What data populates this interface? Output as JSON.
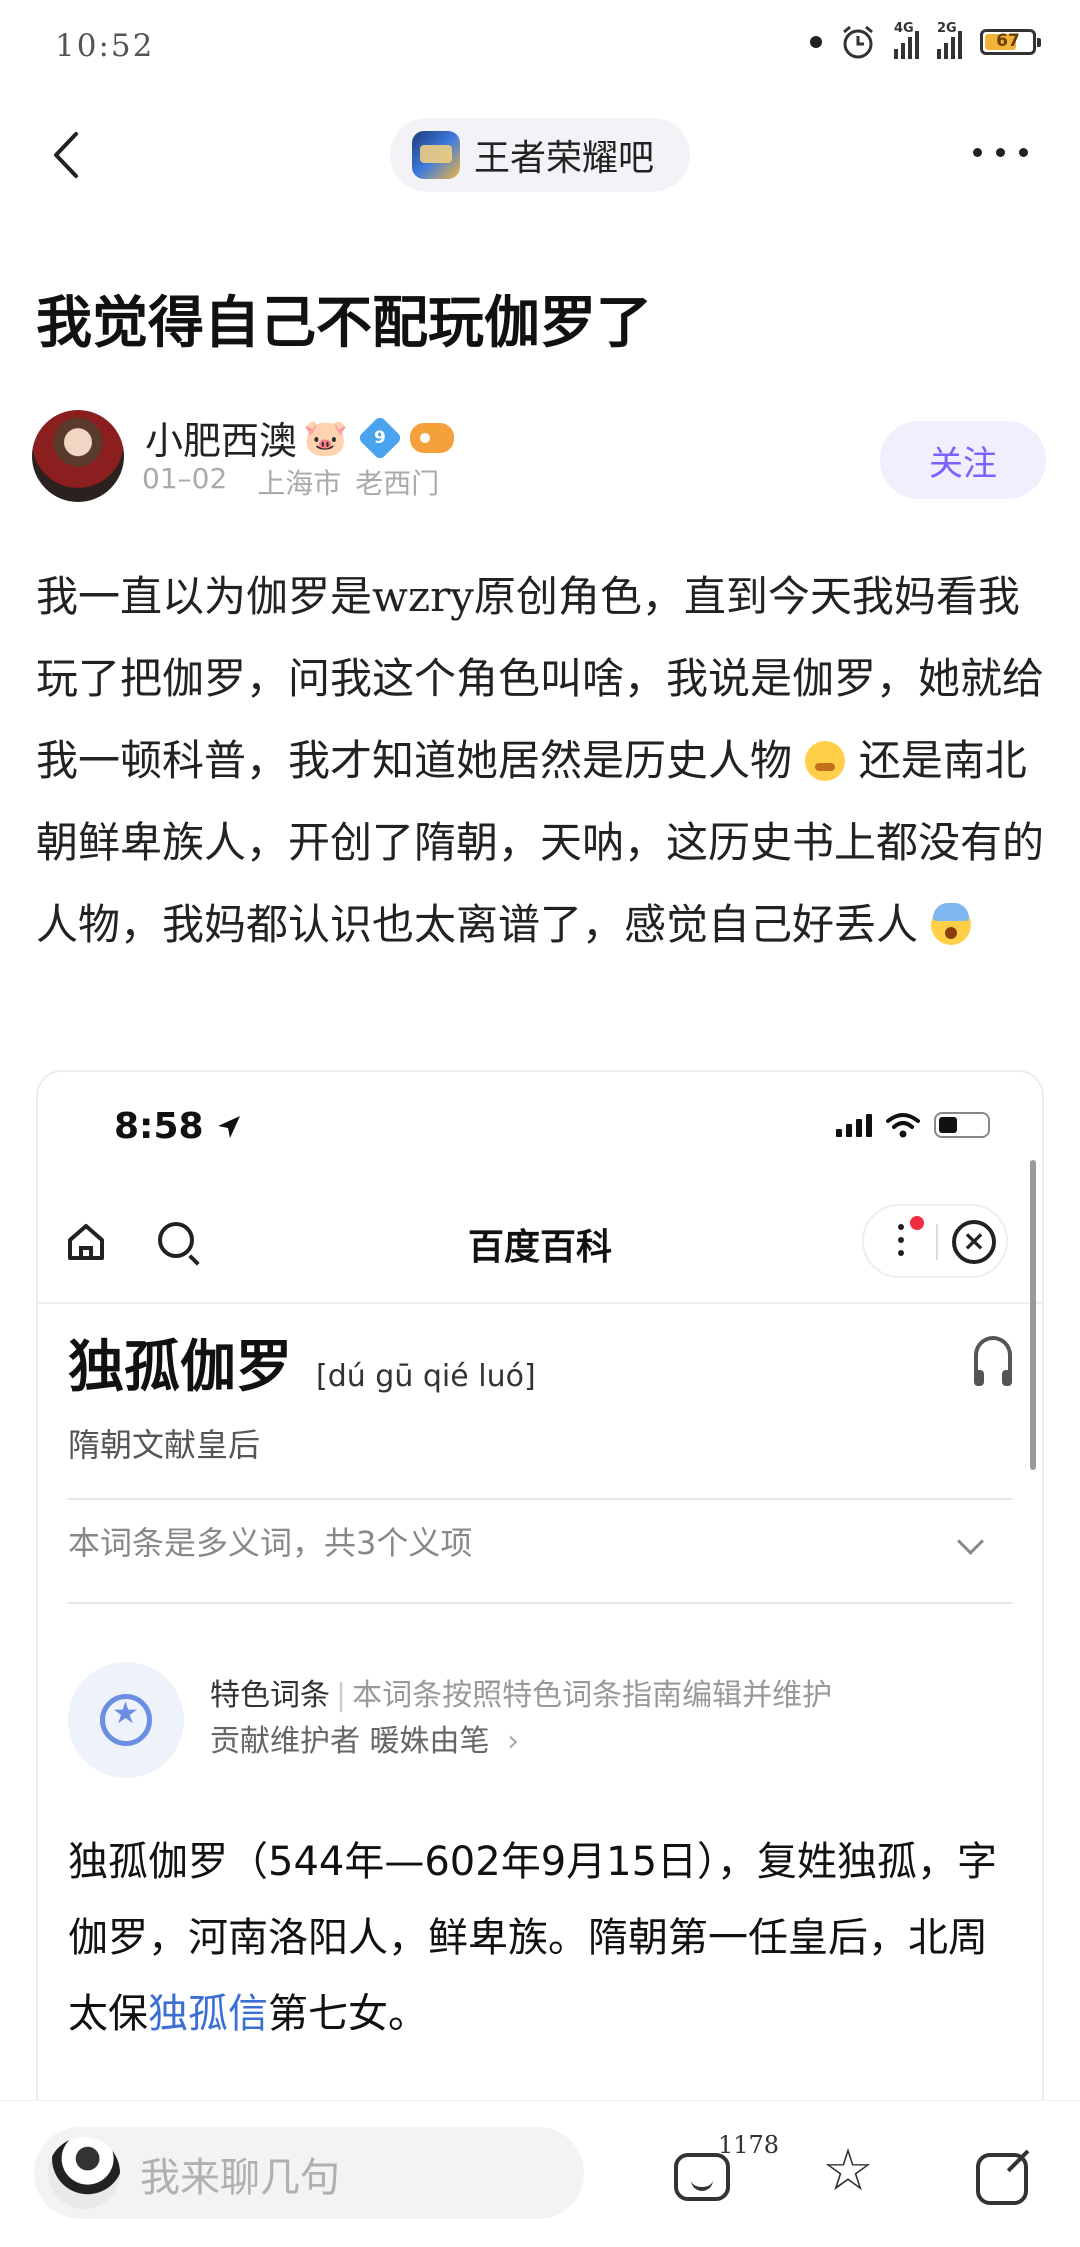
{
  "status_bar": {
    "time": "10:52",
    "net1": "4G",
    "net2": "2G",
    "battery": "67",
    "battery_level": 0.67
  },
  "nav": {
    "forum_name": "王者荣耀吧"
  },
  "post": {
    "title": "我觉得自己不配玩伽罗了",
    "author": {
      "name": "小肥西澳",
      "name_emoji": "🐷",
      "level_badge": "9"
    },
    "meta": {
      "date": "01–02",
      "location": "上海市",
      "area": "老西门"
    },
    "follow_label": "关注",
    "body_part1": "我一直以为伽罗是wzry原创角色，直到今天我妈看我玩了把伽罗，问我这个角色叫啥，我说是伽罗，她就给我一顿科普，我才知道她居然是历史人物",
    "body_part2": " 还是南北朝鲜卑族人，开创了隋朝，天呐，这历史书上都没有的人物，我妈都认识也太离谱了，感觉自己好丢人"
  },
  "embedded": {
    "time": "8:58",
    "page_title": "百度百科",
    "entry_name": "独孤伽罗",
    "entry_pinyin": "[dú gū qié luó]",
    "entry_subtitle": "隋朝文献皇后",
    "polysemy": "本词条是多义词，共3个义项",
    "featured_label": "特色词条",
    "featured_separator": "|",
    "featured_desc": "本词条按照特色词条指南编辑并维护",
    "maintainer": "贡献维护者 暖姝由笔",
    "maintainer_chevron": "›",
    "summary_part1": "独孤伽罗（544年—602年9月15日），复姓独孤，字伽罗，河南洛阳人，鲜卑族。隋朝第一任皇后，北周太保",
    "summary_link": "独孤信",
    "summary_part2": "第七女。"
  },
  "bottom_bar": {
    "input_placeholder": "我来聊几句",
    "comment_count": "1178"
  },
  "colors": {
    "accent": "#7b61ff",
    "link": "#3b6fd4",
    "battery": "#f2b33a"
  }
}
